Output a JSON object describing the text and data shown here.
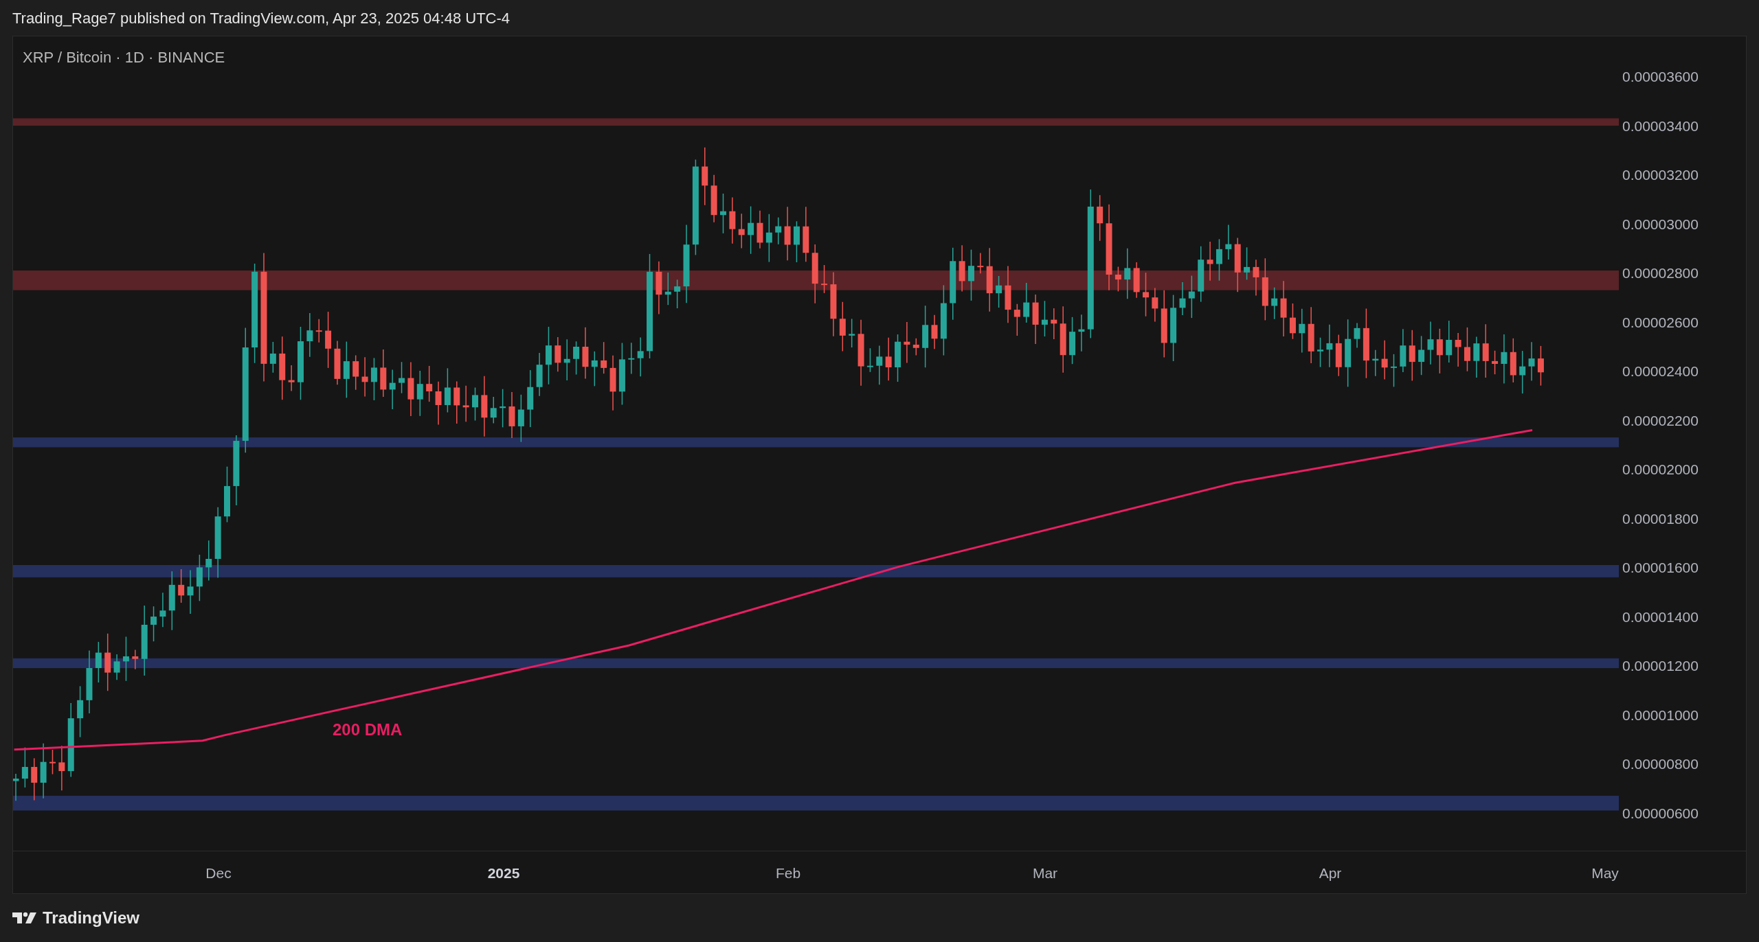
{
  "header": {
    "text": "Trading_Rage7 published on TradingView.com, Apr 23, 2025 04:48 UTC-4"
  },
  "chart": {
    "title": "XRP / Bitcoin · 1D · BINANCE",
    "price_axis": [
      "0.00003600",
      "0.00003400",
      "0.00003200",
      "0.00003000",
      "0.00002800",
      "0.00002600",
      "0.00002400",
      "0.00002200",
      "0.00002000",
      "0.00001800",
      "0.00001600",
      "0.00001400",
      "0.00001200",
      "0.00001000",
      "0.00000800",
      "0.00000600"
    ],
    "time_axis": [
      {
        "label": "Dec",
        "emphasis": false
      },
      {
        "label": "2025",
        "emphasis": true
      },
      {
        "label": "Feb",
        "emphasis": false
      },
      {
        "label": "Mar",
        "emphasis": false
      },
      {
        "label": "Apr",
        "emphasis": false
      },
      {
        "label": "May",
        "emphasis": false
      }
    ],
    "indicator_label": "200 DMA"
  },
  "footer": {
    "logo_text": "TradingView"
  }
}
